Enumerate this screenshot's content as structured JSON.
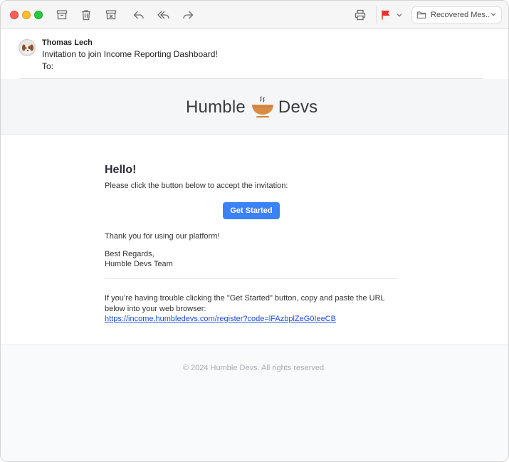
{
  "toolbar": {
    "icons": [
      "archive-icon",
      "trash-icon",
      "junk-icon",
      "reply-icon",
      "reply-all-icon",
      "forward-icon",
      "print-icon",
      "flag-icon",
      "chevron-down-icon",
      "folder-icon"
    ],
    "mailbox_label": "Recovered Mes...",
    "flag_color": "#e8352b"
  },
  "message": {
    "sender": "Thomas Lech",
    "subject": "Invitation to join Income Reporting Dashboard!",
    "to_label": "To:"
  },
  "email": {
    "logo_left": "Humble",
    "logo_right": "Devs",
    "greeting": "Hello!",
    "intro": "Please click the button below to accept the invitation:",
    "cta_label": "Get Started",
    "thanks": "Thank you for using our platform!",
    "regards_line1": "Best Regards,",
    "regards_line2": "Humble Devs Team",
    "trouble_text": "If you’re having trouble clicking the \"Get Started\" button, copy and paste the URL below into your web browser:",
    "url": "https://income.humbledevs.com/register?code=lFAzbplZeG0IeeCB",
    "footer": "© 2024 Humble Devs. All rights reserved."
  },
  "colors": {
    "accent": "#3b82f6",
    "link": "#1d4ed8",
    "cup": "#d98b45"
  }
}
